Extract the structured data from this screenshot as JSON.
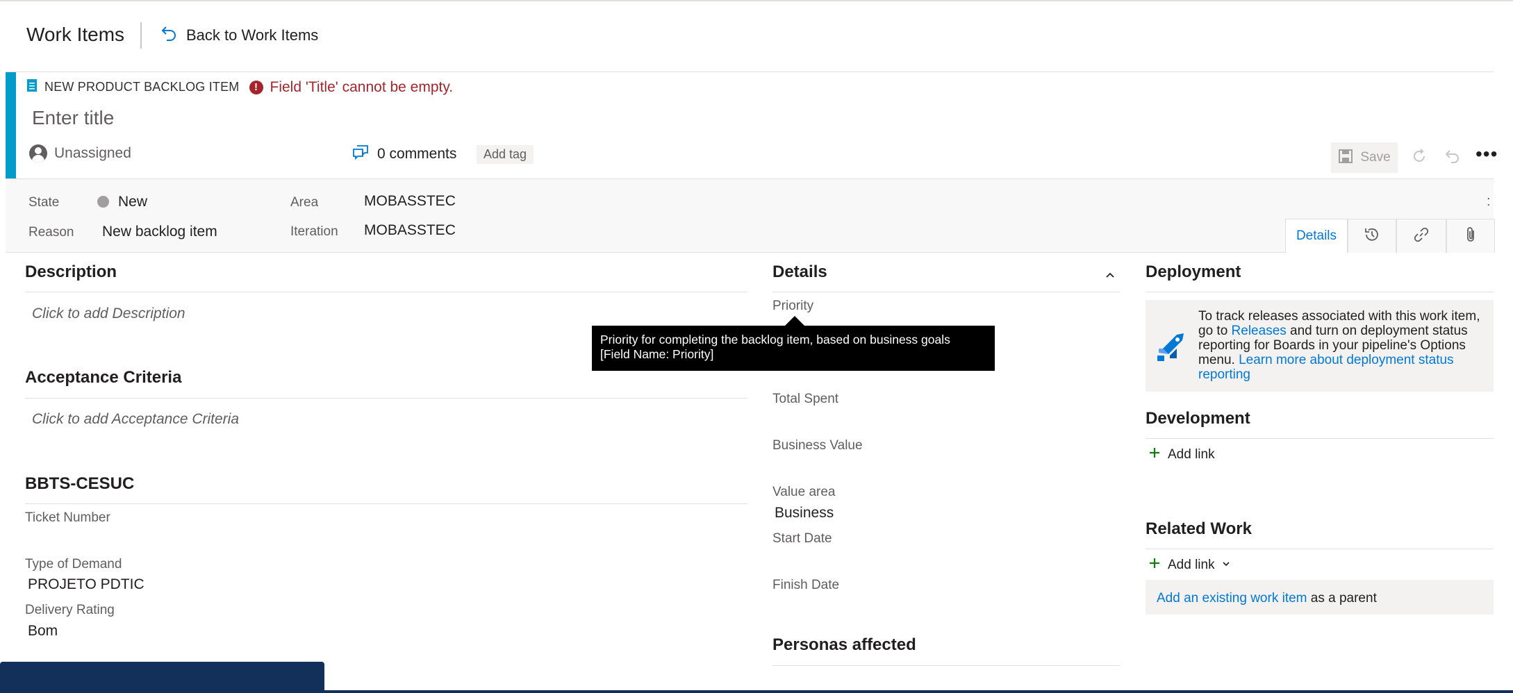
{
  "header": {
    "title": "Work Items",
    "back_label": "Back to Work Items"
  },
  "work_item": {
    "type_label": "NEW PRODUCT BACKLOG ITEM",
    "error_message": "Field 'Title' cannot be empty.",
    "title_placeholder": "Enter title",
    "title_value": "",
    "assignee": "Unassigned",
    "comments": "0 comments",
    "add_tag": "Add tag",
    "save_label": "Save",
    "accent_color": "#009ccc"
  },
  "fields": {
    "state_label": "State",
    "state_value": "New",
    "reason_label": "Reason",
    "reason_value": "New backlog item",
    "area_label": "Area",
    "area_value": "MOBASSTEC",
    "iteration_label": "Iteration",
    "iteration_value": "MOBASSTEC",
    "band_more": ":"
  },
  "tabs": {
    "details": "Details",
    "history_icon": "history-icon",
    "links_icon": "link-icon",
    "attachments_icon": "paperclip-icon"
  },
  "description": {
    "title": "Description",
    "placeholder": "Click to add Description"
  },
  "acceptance": {
    "title": "Acceptance Criteria",
    "placeholder": "Click to add Acceptance Criteria"
  },
  "custom_group": {
    "title": "BBTS-CESUC",
    "ticket_label": "Ticket Number",
    "ticket_value": "",
    "demand_label": "Type of Demand",
    "demand_value": "PROJETO PDTIC",
    "rating_label": "Delivery Rating",
    "rating_value": "Bom"
  },
  "details": {
    "title": "Details",
    "priority_label": "Priority",
    "total_spent_label": "Total Spent",
    "business_value_label": "Business Value",
    "value_area_label": "Value area",
    "value_area_value": "Business",
    "start_date_label": "Start Date",
    "finish_date_label": "Finish Date",
    "personas_title": "Personas affected"
  },
  "tooltip": {
    "line1": "Priority for completing the backlog item, based on business goals",
    "line2": "[Field Name: Priority]"
  },
  "deployment": {
    "title": "Deployment",
    "text_before": "To track releases associated with this work item, go to ",
    "releases_link": "Releases",
    "text_after": " and turn on deployment status reporting for Boards in your pipeline's Options menu. ",
    "learn_link": "Learn more about deployment status reporting"
  },
  "development": {
    "title": "Development",
    "add_link": "Add link"
  },
  "related_work": {
    "title": "Related Work",
    "add_link": "Add link",
    "existing_link": "Add an existing work item",
    "as_parent": " as a parent"
  }
}
